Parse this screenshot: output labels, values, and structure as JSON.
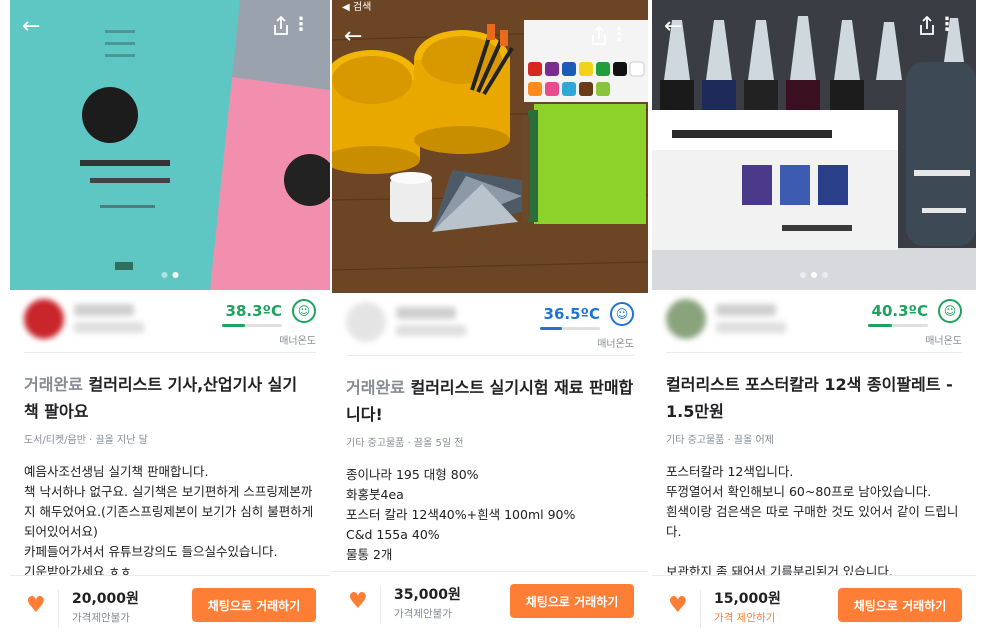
{
  "colors": {
    "accent": "#ff7e36",
    "green": "#1da35d",
    "blue": "#1f74d3",
    "muted": "#868b94"
  },
  "icons": {
    "back": "←",
    "more": "⋮",
    "heart": "♥",
    "face": "☺"
  },
  "listings": [
    {
      "status_bar": "",
      "seller": {
        "temperature": "38.3ºC",
        "temperature_fraction": 0.38,
        "temp_color": "green",
        "temp_label": "매너온도"
      },
      "badge": "거래완료",
      "title": "컬러리스트 기사,산업기사 실기 책 팔아요",
      "meta": "도서/티켓/음반 · 끌올 지난 달",
      "description": [
        "예음사조선생님 실기책 판매합니다.",
        "책 낙서하나 없구요. 실기책은 보기편하게 스프링제본까지 해두었어요.(기존스프링제본이 보기가 심히 불편하게 되어있어서요)",
        "카페들어가셔서 유튜브강의도 들으실수있습니다.",
        "기운받아가세요 ㅎㅎ"
      ],
      "price": "20,000원",
      "negotiation": "가격제안불가",
      "negotiation_color": "muted",
      "chat_label": "채팅으로 거래하기",
      "photo_slide": 1,
      "photo_slides": 2
    },
    {
      "status_bar": "◀ 검색",
      "seller": {
        "temperature": "36.5ºC",
        "temperature_fraction": 0.36,
        "temp_color": "blue",
        "temp_label": "매너온도"
      },
      "badge": "거래완료",
      "title": "컬러리스트 실기시험 재료 판매합니다!",
      "meta": "기타 중고물품 · 끌올 5일 전",
      "description": [
        "종이나라 195 대형 80%",
        "화홍붓4ea",
        "포스터 칼라 12색40%+흰색 100ml 90%",
        "C&d 155a 40%",
        "물통 2개"
      ],
      "price": "35,000원",
      "negotiation": "가격제안불가",
      "negotiation_color": "muted",
      "chat_label": "채팅으로 거래하기",
      "photo_slide": 0,
      "photo_slides": 0
    },
    {
      "status_bar": "",
      "seller": {
        "temperature": "40.3ºC",
        "temperature_fraction": 0.4,
        "temp_color": "green",
        "temp_label": "매너온도"
      },
      "badge": "",
      "title": "컬러리스트 포스터칼라 12색 종이팔레트 - 1.5만원",
      "meta": "기타 중고물품 · 끌올 어제",
      "description": [
        "포스터칼라 12색입니다.",
        "뚜껑열어서 확인해보니 60~80프로 남아있습니다.",
        "흰색이랑 검은색은 따로 구매한 것도 있어서 같이 드립니다.",
        "",
        "보관한지 좀 돼어서 기름분리된거 있습니다."
      ],
      "price": "15,000원",
      "negotiation": "가격 제안하기",
      "negotiation_color": "accent",
      "chat_label": "채팅으로 거래하기",
      "photo_slide": 1,
      "photo_slides": 3
    }
  ]
}
